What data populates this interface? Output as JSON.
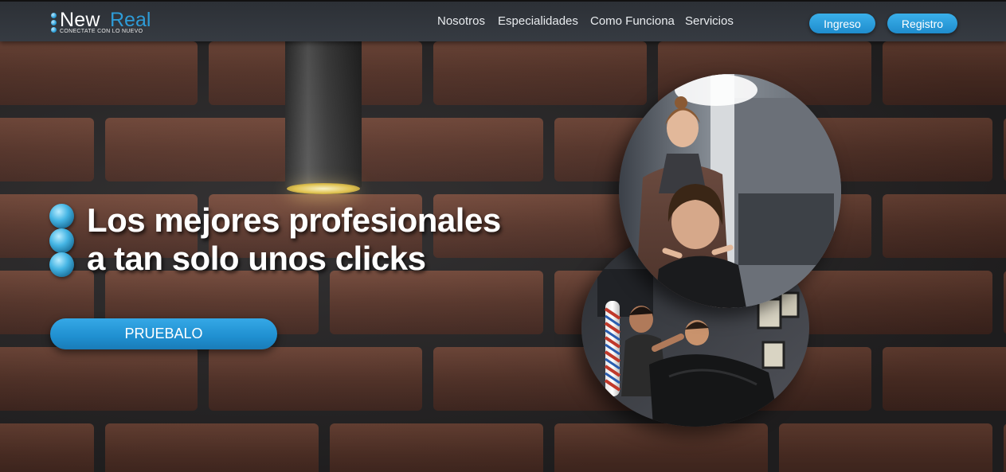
{
  "brand": {
    "name_part1": "New",
    "name_part2": "Real",
    "tagline": "CONECTATE CON LO NUEVO"
  },
  "nav": {
    "links": [
      {
        "label": "Nosotros"
      },
      {
        "label": "Especialidades"
      },
      {
        "label": "Como Funciona"
      },
      {
        "label": "Servicios"
      }
    ],
    "login_label": "Ingreso",
    "register_label": "Registro"
  },
  "hero": {
    "headline_line1": "Los mejores profesionales",
    "headline_line2": "a tan solo unos clicks",
    "cta_label": "PRUEBALO"
  },
  "images": {
    "top_photo": "hairdresser-salon-photo",
    "bottom_photo": "barbershop-photo",
    "background": "brick-wall-background"
  },
  "colors": {
    "accent": "#2e9bd6",
    "navbar": "#32363c",
    "brick": "#6a4234",
    "mortar": "#2b2a2c"
  }
}
